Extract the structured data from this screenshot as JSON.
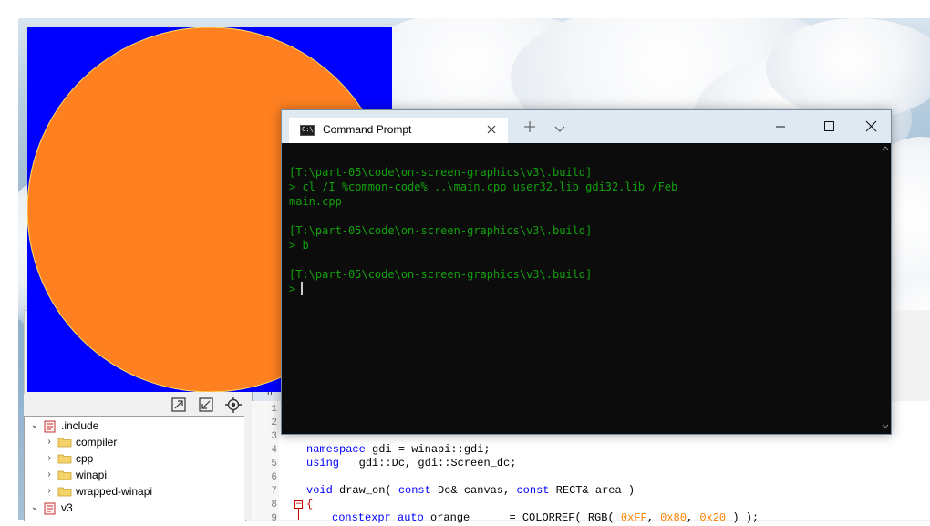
{
  "desktop": {
    "sky_color": "#9db9d1"
  },
  "graphics_window": {
    "background_color": "#0000ff",
    "circle_color": "#ff8020"
  },
  "command_prompt": {
    "tab_title": "Command Prompt",
    "tab_icon_text": "C:\\",
    "text_color": "#13a10e",
    "background_color": "#0c0c0c",
    "lines": [
      "[T:\\part-05\\code\\on-screen-graphics\\v3\\.build]",
      "> cl /I %common-code% ..\\main.cpp user32.lib gdi32.lib /Feb",
      "main.cpp",
      "",
      "[T:\\part-05\\code\\on-screen-graphics\\v3\\.build]",
      "> b",
      "",
      "[T:\\part-05\\code\\on-screen-graphics\\v3\\.build]",
      ">"
    ]
  },
  "project_tree": {
    "items": [
      {
        "label": ".include",
        "kind": "project"
      },
      {
        "label": "compiler",
        "kind": "folder"
      },
      {
        "label": "cpp",
        "kind": "folder"
      },
      {
        "label": "winapi",
        "kind": "folder"
      },
      {
        "label": "wrapped-winapi",
        "kind": "folder"
      },
      {
        "label": "v3",
        "kind": "project"
      }
    ]
  },
  "editor": {
    "tab_label": "m",
    "line_numbers": [
      "1",
      "2",
      "3",
      "4",
      "5",
      "6",
      "7",
      "8",
      "9"
    ],
    "code": {
      "line4": {
        "kw": "namespace",
        "rest": " gdi = winapi::gdi;"
      },
      "line5": {
        "kw": "using",
        "rest": "   gdi::Dc, gdi::Screen_dc;"
      },
      "line7": {
        "kw1": "void",
        "mid1": " draw_on( ",
        "kw2": "const",
        "mid2": " Dc& canvas, ",
        "kw3": "const",
        "rest": " RECT& area )"
      },
      "line8": "{",
      "line9": {
        "kw": "constexpr auto",
        "mid": " orange      = COLORREF( RGB( ",
        "h1": "0xFF",
        "c1": ", ",
        "h2": "0x80",
        "c2": ", ",
        "h3": "0x20",
        "end": " ) );"
      }
    }
  }
}
